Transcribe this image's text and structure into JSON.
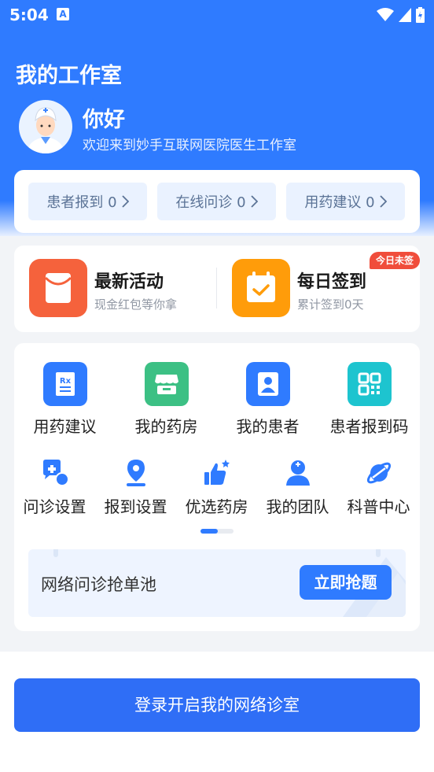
{
  "status_bar": {
    "time": "5:04",
    "notification_letter": "A"
  },
  "header": {
    "title": "我的工作室",
    "greeting": "你好",
    "welcome": "欢迎来到妙手互联网医院医生工作室"
  },
  "stats": [
    {
      "label": "患者报到 0"
    },
    {
      "label": "在线问诊 0"
    },
    {
      "label": "用药建议 0"
    }
  ],
  "activities": {
    "latest": {
      "title": "最新活动",
      "subtitle": "现金红包等你拿",
      "color": "#f5623c"
    },
    "checkin": {
      "title": "每日签到",
      "subtitle": "累计签到0天",
      "badge": "今日未签",
      "color": "#ff9c0a"
    }
  },
  "grid_primary": [
    {
      "label": "用药建议",
      "icon": "prescription-icon",
      "color": "#2f7bff"
    },
    {
      "label": "我的药房",
      "icon": "store-icon",
      "color": "#3cc084"
    },
    {
      "label": "我的患者",
      "icon": "patient-icon",
      "color": "#2f7bff"
    },
    {
      "label": "患者报到码",
      "icon": "qrcode-icon",
      "color": "#1dc4cf"
    }
  ],
  "grid_secondary": [
    {
      "label": "问诊设置",
      "icon": "consult-settings-icon"
    },
    {
      "label": "报到设置",
      "icon": "location-icon"
    },
    {
      "label": "优选药房",
      "icon": "thumbs-up-icon"
    },
    {
      "label": "我的团队",
      "icon": "doctor-icon"
    },
    {
      "label": "科普中心",
      "icon": "planet-icon"
    }
  ],
  "order_pool": {
    "title": "网络问诊抢单池",
    "button": "立即抢题"
  },
  "login_button": "登录开启我的网络诊室"
}
